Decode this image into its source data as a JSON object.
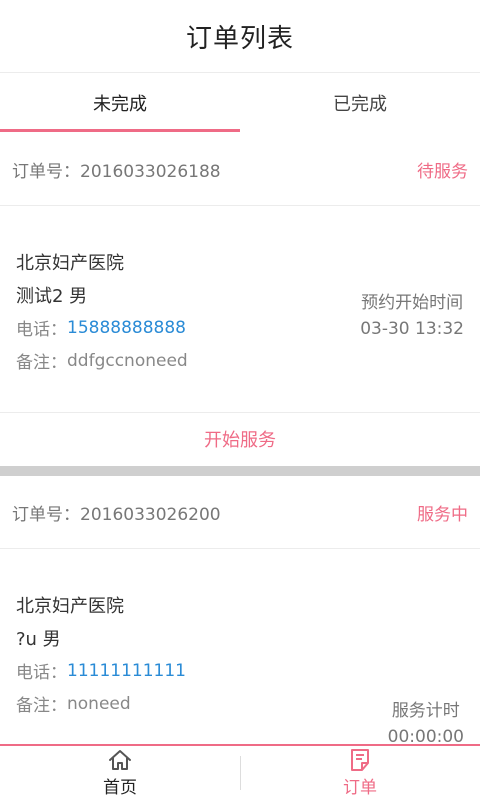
{
  "header": {
    "title": "订单列表"
  },
  "tabs": [
    {
      "label": "未完成",
      "active": true
    },
    {
      "label": "已完成",
      "active": false
    }
  ],
  "orders": [
    {
      "order_label": "订单号：",
      "order_no": "2016033026188",
      "status": "待服务",
      "hospital": "北京妇产医院",
      "patient": "测试2  男",
      "phone_label": "电话：",
      "phone": "15888888888",
      "note_label": "备注：",
      "note": "ddfgccnoneed",
      "right_label": "预约开始时间",
      "right_value": "03-30 13:32",
      "action": "开始服务"
    },
    {
      "order_label": "订单号：",
      "order_no": "2016033026200",
      "status": "服务中",
      "hospital": "北京妇产医院",
      "patient": "?u  男",
      "phone_label": "电话：",
      "phone": "11111111111",
      "note_label": "备注：",
      "note": "noneed",
      "right_label": "服务计时",
      "right_value": "00:00:00"
    }
  ],
  "bottom_nav": [
    {
      "label": "首页",
      "icon": "home-icon",
      "active": false
    },
    {
      "label": "订单",
      "icon": "order-list-icon",
      "active": true
    }
  ],
  "colors": {
    "accent": "#ef6b86",
    "link": "#2a8bd6",
    "separator": "#cfcfcf"
  }
}
